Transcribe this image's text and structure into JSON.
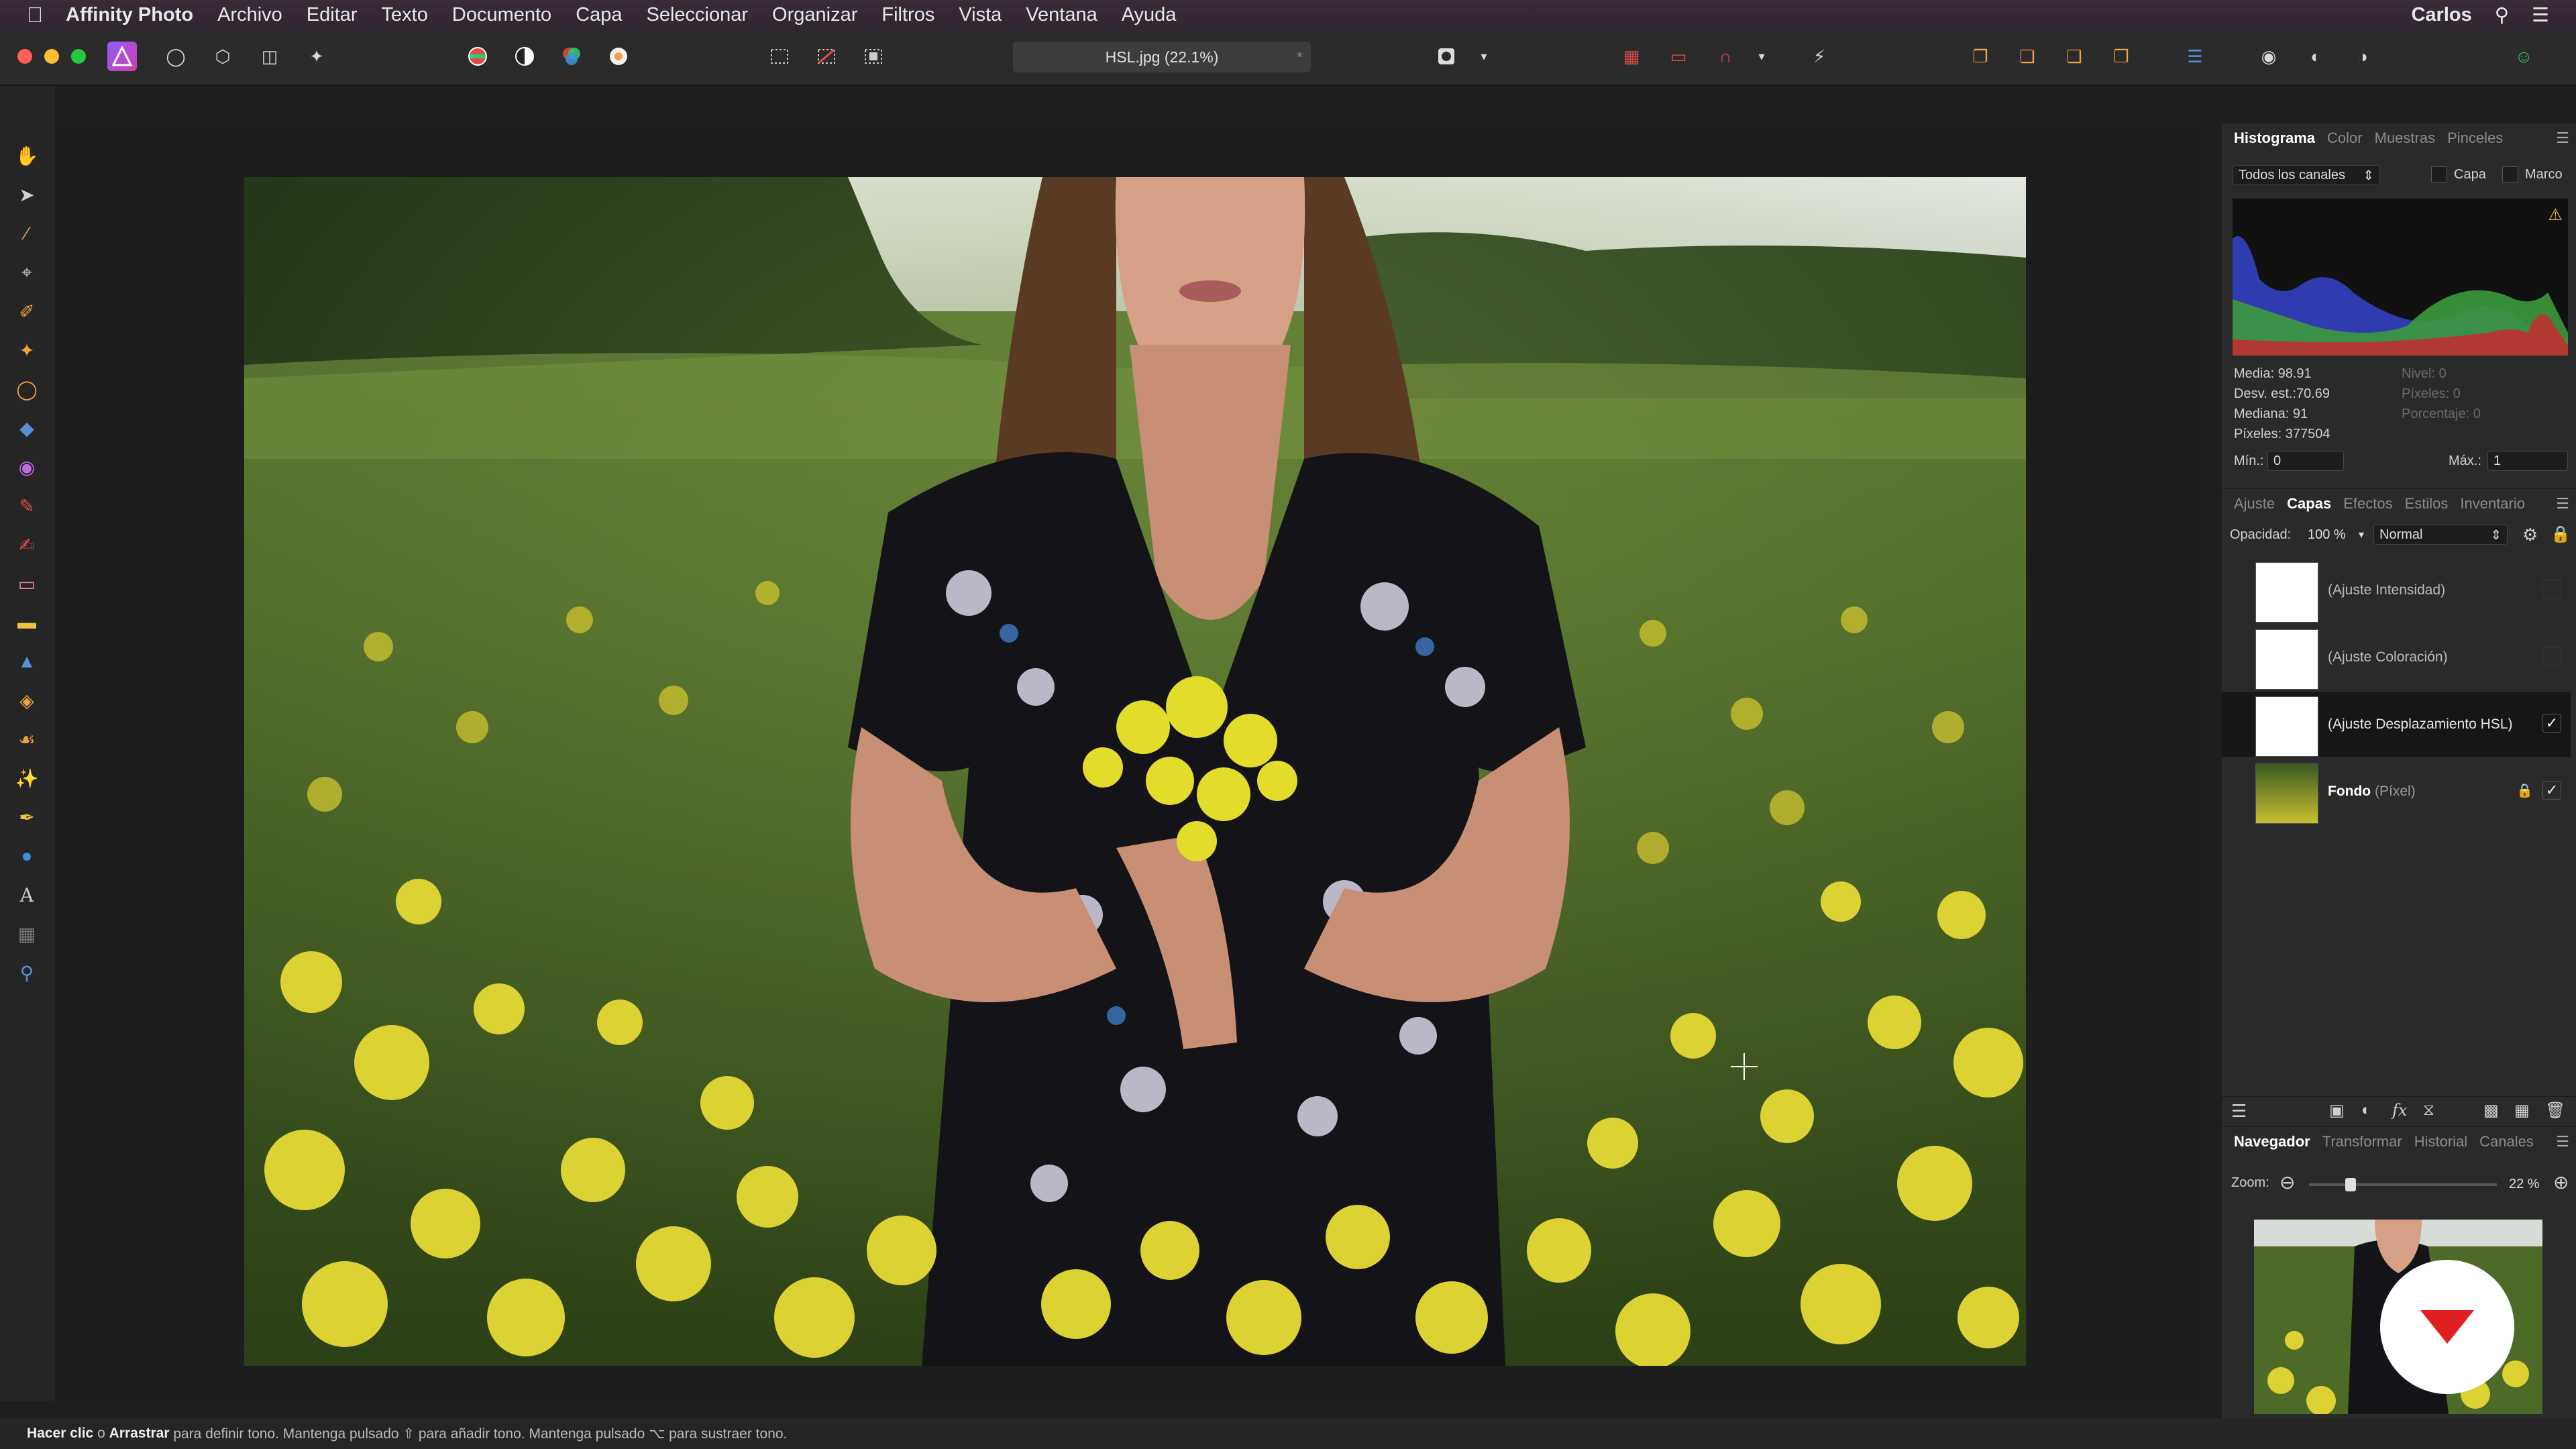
{
  "menubar": {
    "app_name": "Affinity Photo",
    "items": [
      "Archivo",
      "Editar",
      "Texto",
      "Documento",
      "Capa",
      "Seleccionar",
      "Organizar",
      "Filtros",
      "Vista",
      "Ventana",
      "Ayuda"
    ],
    "user": "Carlos"
  },
  "toolbar": {
    "document_tab": "HSL.jpg (22.1%)",
    "tab_star": "*"
  },
  "histogram_panel": {
    "tabs": [
      "Histograma",
      "Color",
      "Muestras",
      "Pinceles"
    ],
    "active_tab": "Histograma",
    "channel_select": "Todos los canales",
    "capa_label": "Capa",
    "marco_label": "Marco",
    "stats_left": [
      "Media: 98.91",
      "Desv. est.:70.69",
      "Mediana: 91",
      "Píxeles: 377504"
    ],
    "stats_right": [
      "Nivel: 0",
      "Píxeles: 0",
      "Porcentaje: 0"
    ],
    "min_label": "Mín.:",
    "min_value": "0",
    "max_label": "Máx.:",
    "max_value": "1"
  },
  "layers_panel": {
    "tabs": [
      "Ajuste",
      "Capas",
      "Efectos",
      "Estilos",
      "Inventario"
    ],
    "active_tab": "Capas",
    "opacity_label": "Opacidad:",
    "opacity_value": "100 %",
    "blend_mode": "Normal",
    "layers": [
      {
        "name": "(Ajuste Intensidad)",
        "checked": ""
      },
      {
        "name": "(Ajuste Coloración)",
        "checked": ""
      },
      {
        "name": "(Ajuste Desplazamiento HSL)",
        "checked": "✓"
      },
      {
        "name": "Fondo",
        "type": "(Píxel)",
        "checked": "✓"
      }
    ]
  },
  "navigator_panel": {
    "tabs": [
      "Navegador",
      "Transformar",
      "Historial",
      "Canales"
    ],
    "active_tab": "Navegador",
    "zoom_label": "Zoom:",
    "zoom_value": "22 %",
    "zoom_level": 0.22
  },
  "statusbar": {
    "bold1": "Hacer clic",
    "text1": " o ",
    "bold2": "Arrastrar",
    "text2": " para definir tono. Mantenga pulsado ⇧ para añadir tono. Mantenga pulsado ⌥ para sustraer tono."
  },
  "colors": {
    "accent": "#5a8fd8",
    "menubar_bg": "#2f2530",
    "panel_bg": "#2a2a2b"
  }
}
